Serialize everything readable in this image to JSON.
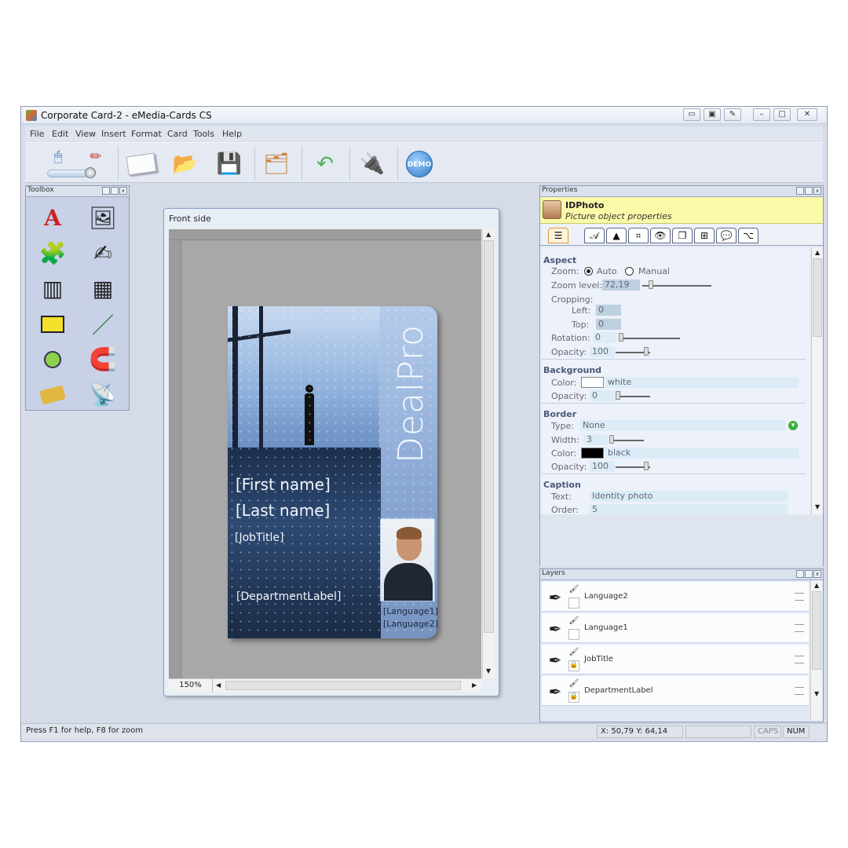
{
  "window": {
    "title": "Corporate Card-2 - eMedia-Cards CS"
  },
  "menu": [
    "File",
    "Edit",
    "View",
    "Insert",
    "Format",
    "Card",
    "Tools",
    "Help"
  ],
  "toolbar": {
    "demo_label": "DEMO"
  },
  "toolbox": {
    "title": "Toolbox"
  },
  "document": {
    "title": "Front side",
    "zoom": "150%"
  },
  "card": {
    "brand": "DealPro",
    "first_name": "[First name]",
    "last_name": "[Last name]",
    "job_title": "[JobTitle]",
    "department": "[DepartmentLabel]",
    "language1": "[Language1]",
    "language2": "[Language2]"
  },
  "properties": {
    "title": "Properties",
    "object_name": "IDPhoto",
    "object_desc": "Picture object properties",
    "aspect": {
      "heading": "Aspect",
      "zoom_label": "Zoom:",
      "zoom_auto": "Auto",
      "zoom_manual": "Manual",
      "zoom_level_label": "Zoom level:",
      "zoom_level": "72,19",
      "cropping_label": "Cropping:",
      "left_label": "Left:",
      "left": "0",
      "top_label": "Top:",
      "top": "0",
      "rotation_label": "Rotation:",
      "rotation": "0",
      "opacity_label": "Opacity:",
      "opacity": "100"
    },
    "background": {
      "heading": "Background",
      "color_label": "Color:",
      "color_name": "white",
      "color": "#ffffff",
      "opacity_label": "Opacity:",
      "opacity": "0"
    },
    "border": {
      "heading": "Border",
      "type_label": "Type:",
      "type": "None",
      "width_label": "Width:",
      "width": "3",
      "color_label": "Color:",
      "color_name": "black",
      "color": "#000000",
      "opacity_label": "Opacity:",
      "opacity": "100"
    },
    "caption": {
      "heading": "Caption",
      "text_label": "Text:",
      "text": "Identity photo",
      "order_label": "Order:",
      "order": "5"
    }
  },
  "layers": {
    "title": "Layers",
    "items": [
      "Language2",
      "Language1",
      "JobTitle",
      "DepartmentLabel"
    ]
  },
  "status": {
    "help": "Press F1 for help, F8 for zoom",
    "coords": "X: 50,79  Y: 64,14",
    "caps": "CAPS",
    "num": "NUM"
  }
}
